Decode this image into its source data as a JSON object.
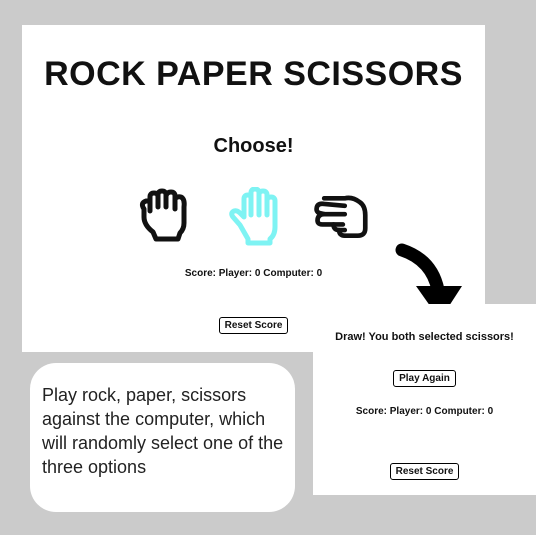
{
  "game": {
    "title": "ROCK PAPER SCISSORS",
    "prompt": "Choose!",
    "choices": [
      {
        "name": "rock",
        "icon": "fist-icon",
        "color": "#111111"
      },
      {
        "name": "paper",
        "icon": "open-hand-icon",
        "color": "#7ef3f3"
      },
      {
        "name": "scissors",
        "icon": "scissors-hand-icon",
        "color": "#111111"
      }
    ],
    "score": "Score: Player: 0 Computer: 0",
    "reset_label": "Reset Score"
  },
  "result": {
    "message": "Draw! You both selected scissors!",
    "play_again_label": "Play Again",
    "score": "Score: Player: 0 Computer: 0",
    "reset_label": "Reset Score"
  },
  "caption": "Play rock, paper, scissors against the computer, which will randomly select one of the three options"
}
